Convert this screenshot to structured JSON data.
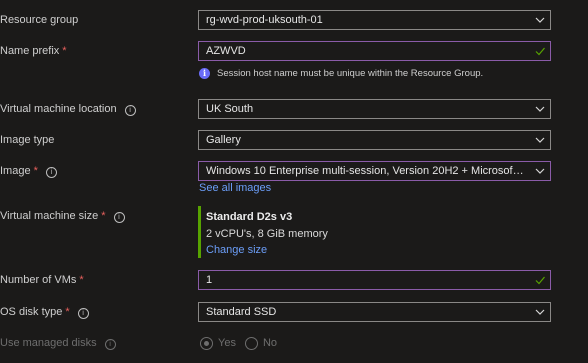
{
  "resource_group": {
    "label": "Resource group",
    "value": "rg-wvd-prod-uksouth-01"
  },
  "name_prefix": {
    "label": "Name prefix",
    "value": "AZWVD",
    "note": "Session host name must be unique within the Resource Group."
  },
  "vm_location": {
    "label": "Virtual machine location",
    "value": "UK South"
  },
  "image_type": {
    "label": "Image type",
    "value": "Gallery"
  },
  "image": {
    "label": "Image",
    "value": "Windows 10 Enterprise multi-session, Version 20H2 + Microsoft 365 ...",
    "see_all": "See all images"
  },
  "vm_size": {
    "label": "Virtual machine size",
    "name": "Standard D2s v3",
    "spec": "2 vCPU's, 8 GiB memory",
    "change": "Change size"
  },
  "num_vms": {
    "label": "Number of VMs",
    "value": "1"
  },
  "os_disk": {
    "label": "OS disk type",
    "value": "Standard SSD"
  },
  "managed_disks": {
    "label": "Use managed disks",
    "options": [
      "Yes",
      "No"
    ],
    "selected": "Yes"
  },
  "colors": {
    "background": "#1b1a19",
    "required": "#e8605d",
    "link": "#6c9ef8",
    "valid": "#57a300",
    "focus": "#8a5ba8"
  }
}
